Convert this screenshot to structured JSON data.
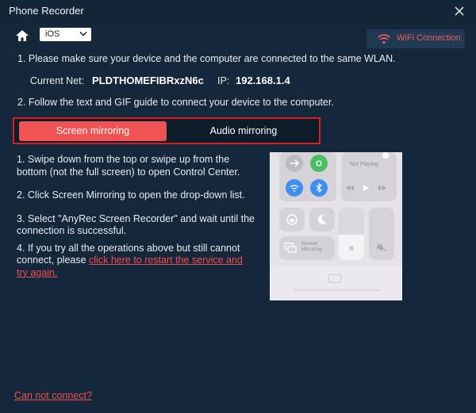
{
  "window": {
    "title": "Phone Recorder"
  },
  "toolbar": {
    "device_select": "iOS",
    "wifi_button": "WiFi Connection"
  },
  "instructions": {
    "step1": "1. Please make sure your device and the computer are connected to the same WLAN.",
    "current_net_label": "Current Net:",
    "current_net_value": "PLDTHOMEFIBRxzN6c",
    "ip_label": "IP:",
    "ip_value": "192.168.1.4",
    "step2": "2. Follow the text and GIF guide to connect your device to the computer."
  },
  "tabs": [
    {
      "label": "Screen mirroring",
      "active": true
    },
    {
      "label": "Audio mirroring",
      "active": false
    }
  ],
  "guide": {
    "s1": "1. Swipe down from the top or swipe up from the bottom (not the full screen) to open Control Center.",
    "s2": "2. Click Screen Mirroring to open the drop-down list.",
    "s3": "3. Select \"AnyRec Screen Recorder\" and wait until the connection is successful.",
    "s4_prefix": "4. If you try all the operations above but still cannot connect, please ",
    "s4_link": "click here to restart the service and try again."
  },
  "control_center": {
    "now_playing": "Not Playing",
    "screen_mirroring": "Screen Mirroring"
  },
  "footer": {
    "cannot_connect": "Can not connect?"
  },
  "colors": {
    "accent": "#f05353",
    "background": "#15283b",
    "tab_border": "#d41f26"
  }
}
